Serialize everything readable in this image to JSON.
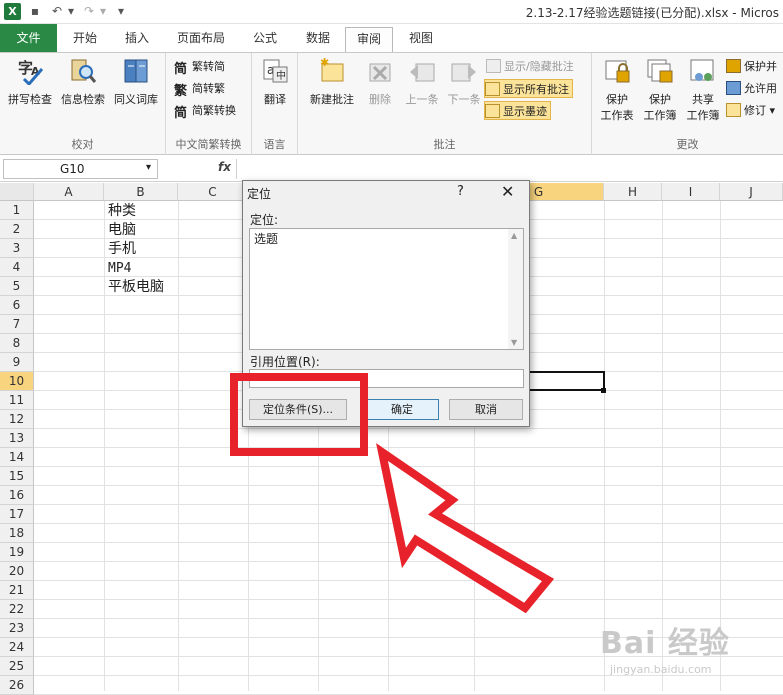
{
  "titlebar": {
    "title": "2.13-2.17经验选题链接(已分配).xlsx - Micros",
    "logo": "X"
  },
  "tabs": [
    {
      "label": "文件"
    },
    {
      "label": "开始"
    },
    {
      "label": "插入"
    },
    {
      "label": "页面布局"
    },
    {
      "label": "公式"
    },
    {
      "label": "数据"
    },
    {
      "label": "审阅"
    },
    {
      "label": "视图"
    }
  ],
  "ribbon": {
    "proofing": {
      "label": "校对",
      "spell": "拼写检查",
      "research": "信息检索",
      "thesaurus": "同义词库"
    },
    "chinese": {
      "label": "中文简繁转换",
      "to_simplified": "繁转简",
      "to_traditional": "简转繁",
      "convert": "简繁转换"
    },
    "language": {
      "label": "语言",
      "translate": "翻译"
    },
    "comments": {
      "label": "批注",
      "new": "新建批注",
      "delete": "删除",
      "prev": "上一条",
      "next": "下一条",
      "show_hide": "显示/隐藏批注",
      "show_all": "显示所有批注",
      "show_ink": "显示墨迹"
    },
    "changes": {
      "label": "更改",
      "protect_sheet_1": "保护",
      "protect_sheet_2": "工作表",
      "protect_wb_1": "保护",
      "protect_wb_2": "工作簿",
      "share_wb_1": "共享",
      "share_wb_2": "工作簿",
      "protect_share": "保护并",
      "allow_users": "允许用",
      "track": "修订"
    }
  },
  "formula_bar": {
    "name_box": "G10",
    "fx": "fx",
    "value": ""
  },
  "sheet": {
    "columns": [
      "A",
      "B",
      "C",
      "D",
      "E",
      "F",
      "G",
      "H",
      "I",
      "J"
    ],
    "rows": [
      "1",
      "2",
      "3",
      "4",
      "5",
      "6",
      "7",
      "8",
      "9",
      "10",
      "11",
      "12",
      "13",
      "14",
      "15",
      "16",
      "17",
      "18",
      "19",
      "20",
      "21",
      "22",
      "23",
      "24",
      "25",
      "26"
    ],
    "cells_b": [
      "种类",
      "电脑",
      "手机",
      "MP4",
      "平板电脑"
    ],
    "active_cell": "G10"
  },
  "dialog": {
    "title": "定位",
    "help": "?",
    "close": "✕",
    "goto_label": "定位:",
    "list_items": [
      "选题"
    ],
    "reference_label": "引用位置(R):",
    "reference_value": "",
    "special_button": "定位条件(S)...",
    "ok_button": "确定",
    "cancel_button": "取消"
  },
  "annotation": {
    "color": "#e8222a"
  },
  "watermark": {
    "brand": "Bai 经验",
    "url": "jingyan.baidu.com"
  }
}
